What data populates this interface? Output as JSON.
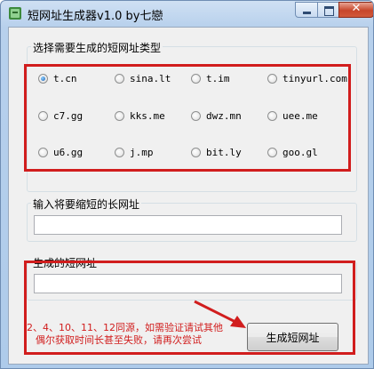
{
  "window": {
    "title": "短网址生成器v1.0   by七戀",
    "close_glyph": "✕"
  },
  "type_group": {
    "caption": "选择需要生成的短网址类型",
    "options": [
      {
        "label": "t.cn",
        "selected": true
      },
      {
        "label": "sina.lt",
        "selected": false
      },
      {
        "label": "t.im",
        "selected": false
      },
      {
        "label": "tinyurl.com",
        "selected": false
      },
      {
        "label": "c7.gg",
        "selected": false
      },
      {
        "label": "kks.me",
        "selected": false
      },
      {
        "label": "dwz.mn",
        "selected": false
      },
      {
        "label": "uee.me",
        "selected": false
      },
      {
        "label": "u6.gg",
        "selected": false
      },
      {
        "label": "j.mp",
        "selected": false
      },
      {
        "label": "bit.ly",
        "selected": false
      },
      {
        "label": "goo.gl",
        "selected": false
      }
    ]
  },
  "long_url": {
    "caption": "输入将要缩短的长网址",
    "value": ""
  },
  "short_url": {
    "caption": "生成的短网址",
    "value": ""
  },
  "generate_button": {
    "label": "生成短网址"
  },
  "note": {
    "line1": "2、4、10、11、12同源，如需验证请试其他",
    "line2": "偶尔获取时间长甚至失败，请再次尝试"
  },
  "colors": {
    "annotation_red": "#d11d1d"
  }
}
